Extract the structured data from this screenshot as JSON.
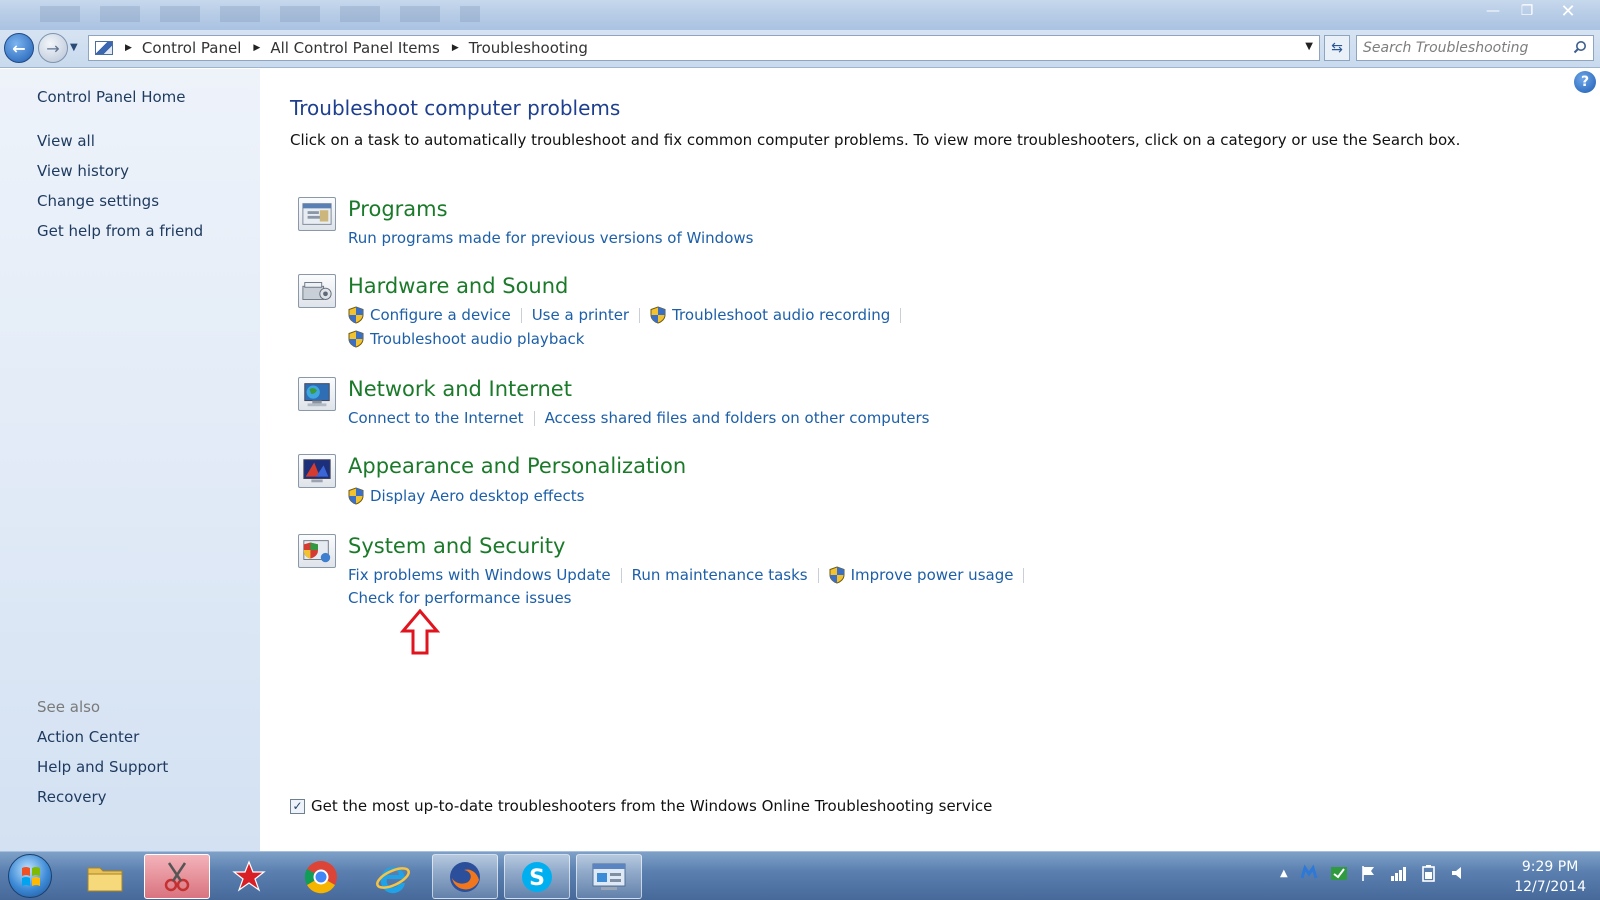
{
  "window": {
    "minimize": "—",
    "maximize": "❐",
    "close": "✕"
  },
  "address": {
    "crumbs": [
      "Control Panel",
      "All Control Panel Items",
      "Troubleshooting"
    ],
    "search_placeholder": "Search Troubleshooting"
  },
  "sidebar": {
    "home": "Control Panel Home",
    "links": [
      "View all",
      "View history",
      "Change settings",
      "Get help from a friend"
    ],
    "see_also_heading": "See also",
    "see_also": [
      "Action Center",
      "Help and Support",
      "Recovery"
    ]
  },
  "main": {
    "title": "Troubleshoot computer problems",
    "description": "Click on a task to automatically troubleshoot and fix common computer problems. To view more troubleshooters, click on a category or use the Search box.",
    "categories": [
      {
        "title": "Programs",
        "icon": "programs-icon",
        "tasks": [
          "Run programs made for previous versions of Windows"
        ]
      },
      {
        "title": "Hardware and Sound",
        "icon": "hardware-sound-icon",
        "tasks": [
          "Configure a device",
          "Use a printer",
          "Troubleshoot audio recording",
          "Troubleshoot audio playback"
        ]
      },
      {
        "title": "Network and Internet",
        "icon": "network-icon",
        "tasks": [
          "Connect to the Internet",
          "Access shared files and folders on other computers"
        ]
      },
      {
        "title": "Appearance and Personalization",
        "icon": "appearance-icon",
        "tasks": [
          "Display Aero desktop effects"
        ]
      },
      {
        "title": "System and Security",
        "icon": "system-security-icon",
        "tasks": [
          "Fix problems with Windows Update",
          "Run maintenance tasks",
          "Improve power usage",
          "Check for performance issues"
        ]
      }
    ],
    "online_checkbox_label": "Get the most up-to-date troubleshooters from the Windows Online Troubleshooting service",
    "online_checkbox_checked": true
  },
  "taskbar": {
    "apps": [
      "windows-explorer-icon",
      "snipping-tool-icon",
      "pokerstars-icon",
      "chrome-icon",
      "internet-explorer-icon",
      "firefox-icon",
      "skype-icon",
      "control-panel-icon"
    ],
    "time": "9:29 PM",
    "date": "12/7/2014"
  },
  "colors": {
    "category_title": "#1b7a2a",
    "task_link": "#1d5fa8",
    "page_title": "#1e3f8f",
    "annotation_arrow": "#e0141e"
  }
}
